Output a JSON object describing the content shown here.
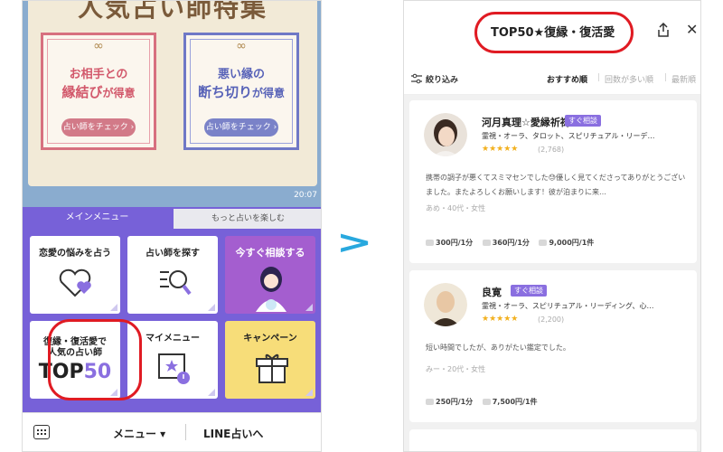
{
  "left": {
    "banner_title": "人気占い師特集",
    "cards": [
      {
        "line1": "お相手との",
        "line2a": "縁結び",
        "line2b": "が得意",
        "button": "占い師をチェック ›"
      },
      {
        "line1": "悪い縁の",
        "line2a": "断ち切り",
        "line2b": "が得意",
        "button": "占い師をチェック ›"
      }
    ],
    "chat_time": "20:07",
    "tabs": {
      "main": "メインメニュー",
      "more": "もっと占いを楽しむ"
    },
    "tiles": {
      "love": "恋愛の悩みを占う",
      "find": "占い師を探す",
      "consult": "今すぐ相談する",
      "top50_l1": "復縁・復活愛で",
      "top50_l2": "人気の占い師",
      "top50_a": "TOP",
      "top50_b": "50",
      "mymenu": "マイメニュー",
      "campaign": "キャンペーン"
    },
    "bottom": {
      "menu": "メニュー ▾",
      "line": "LINE占いへ"
    }
  },
  "arrow": ">",
  "right": {
    "title": "TOP50★復縁・復活愛",
    "filter": "絞り込み",
    "sort": {
      "recommended": "おすすめ順",
      "count": "回数が多い順",
      "newest": "最新順"
    },
    "fortune_tellers": [
      {
        "name": "河月真理☆愛縁祈祷",
        "badge": "すぐ相談",
        "categories": "霊視・オーラ、タロット、スピリチュアル・リーデ…",
        "stars": "★★★★★",
        "rating": 5,
        "reviews": "(2,768)",
        "comment": "携帯の調子が悪くてスミマセンでした😓優しく見てくださってありがとうございました。またよろしくお願いします！彼が泊まりに来…",
        "user": "あめ・40代・女性",
        "prices": [
          "300円/1分",
          "360円/1分",
          "9,000円/1件"
        ]
      },
      {
        "name": "良寛",
        "badge": "すぐ相談",
        "categories": "霊視・オーラ、スピリチュアル・リーディング、心…",
        "stars": "★★★★★",
        "rating": 4.5,
        "reviews": "(2,200)",
        "comment": "短い時間でしたが、ありがたい鑑定でした。",
        "user": "みー・20代・女性",
        "prices": [
          "250円/1分",
          "7,500円/1件"
        ]
      }
    ]
  },
  "colors": {
    "accent_purple": "#7761d8",
    "highlight_red": "#e01b23",
    "arrow_blue": "#28a8de",
    "star": "#f2b01e"
  }
}
